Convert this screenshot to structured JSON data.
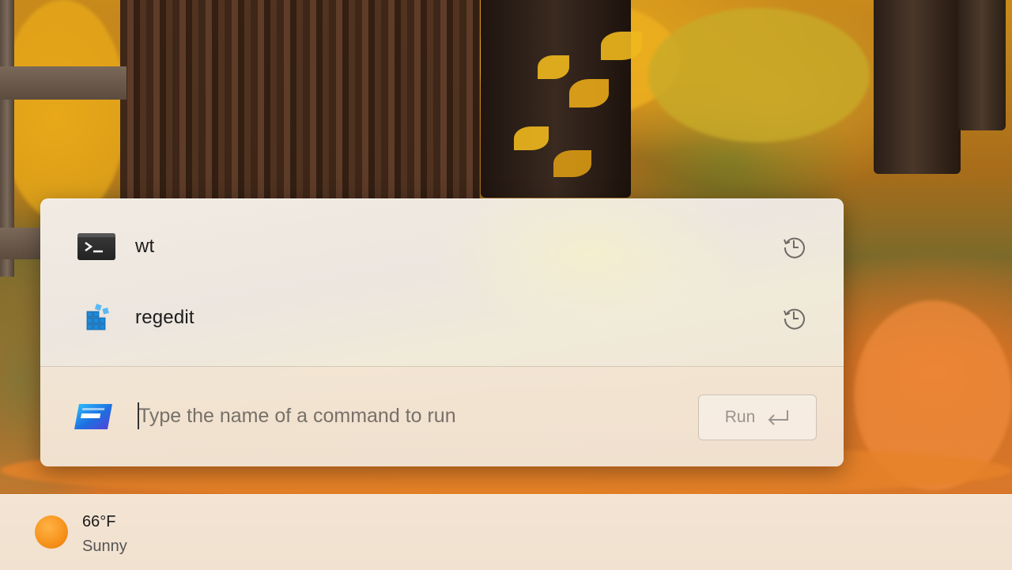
{
  "run_dialog": {
    "history": [
      {
        "label": "wt",
        "icon": "terminal-icon"
      },
      {
        "label": "regedit",
        "icon": "registry-editor-icon"
      }
    ],
    "history_icon": "history-clock-icon",
    "app_icon": "run-app-icon",
    "input": {
      "value": "",
      "placeholder": "Type the name of a command to run"
    },
    "run_button": {
      "label": "Run",
      "icon": "enter-arrow-icon"
    }
  },
  "taskbar": {
    "weather": {
      "temperature": "66°F",
      "condition": "Sunny",
      "icon": "sun-icon"
    }
  },
  "colors": {
    "accent": "#2a7de1",
    "sun": "#f7941d"
  }
}
